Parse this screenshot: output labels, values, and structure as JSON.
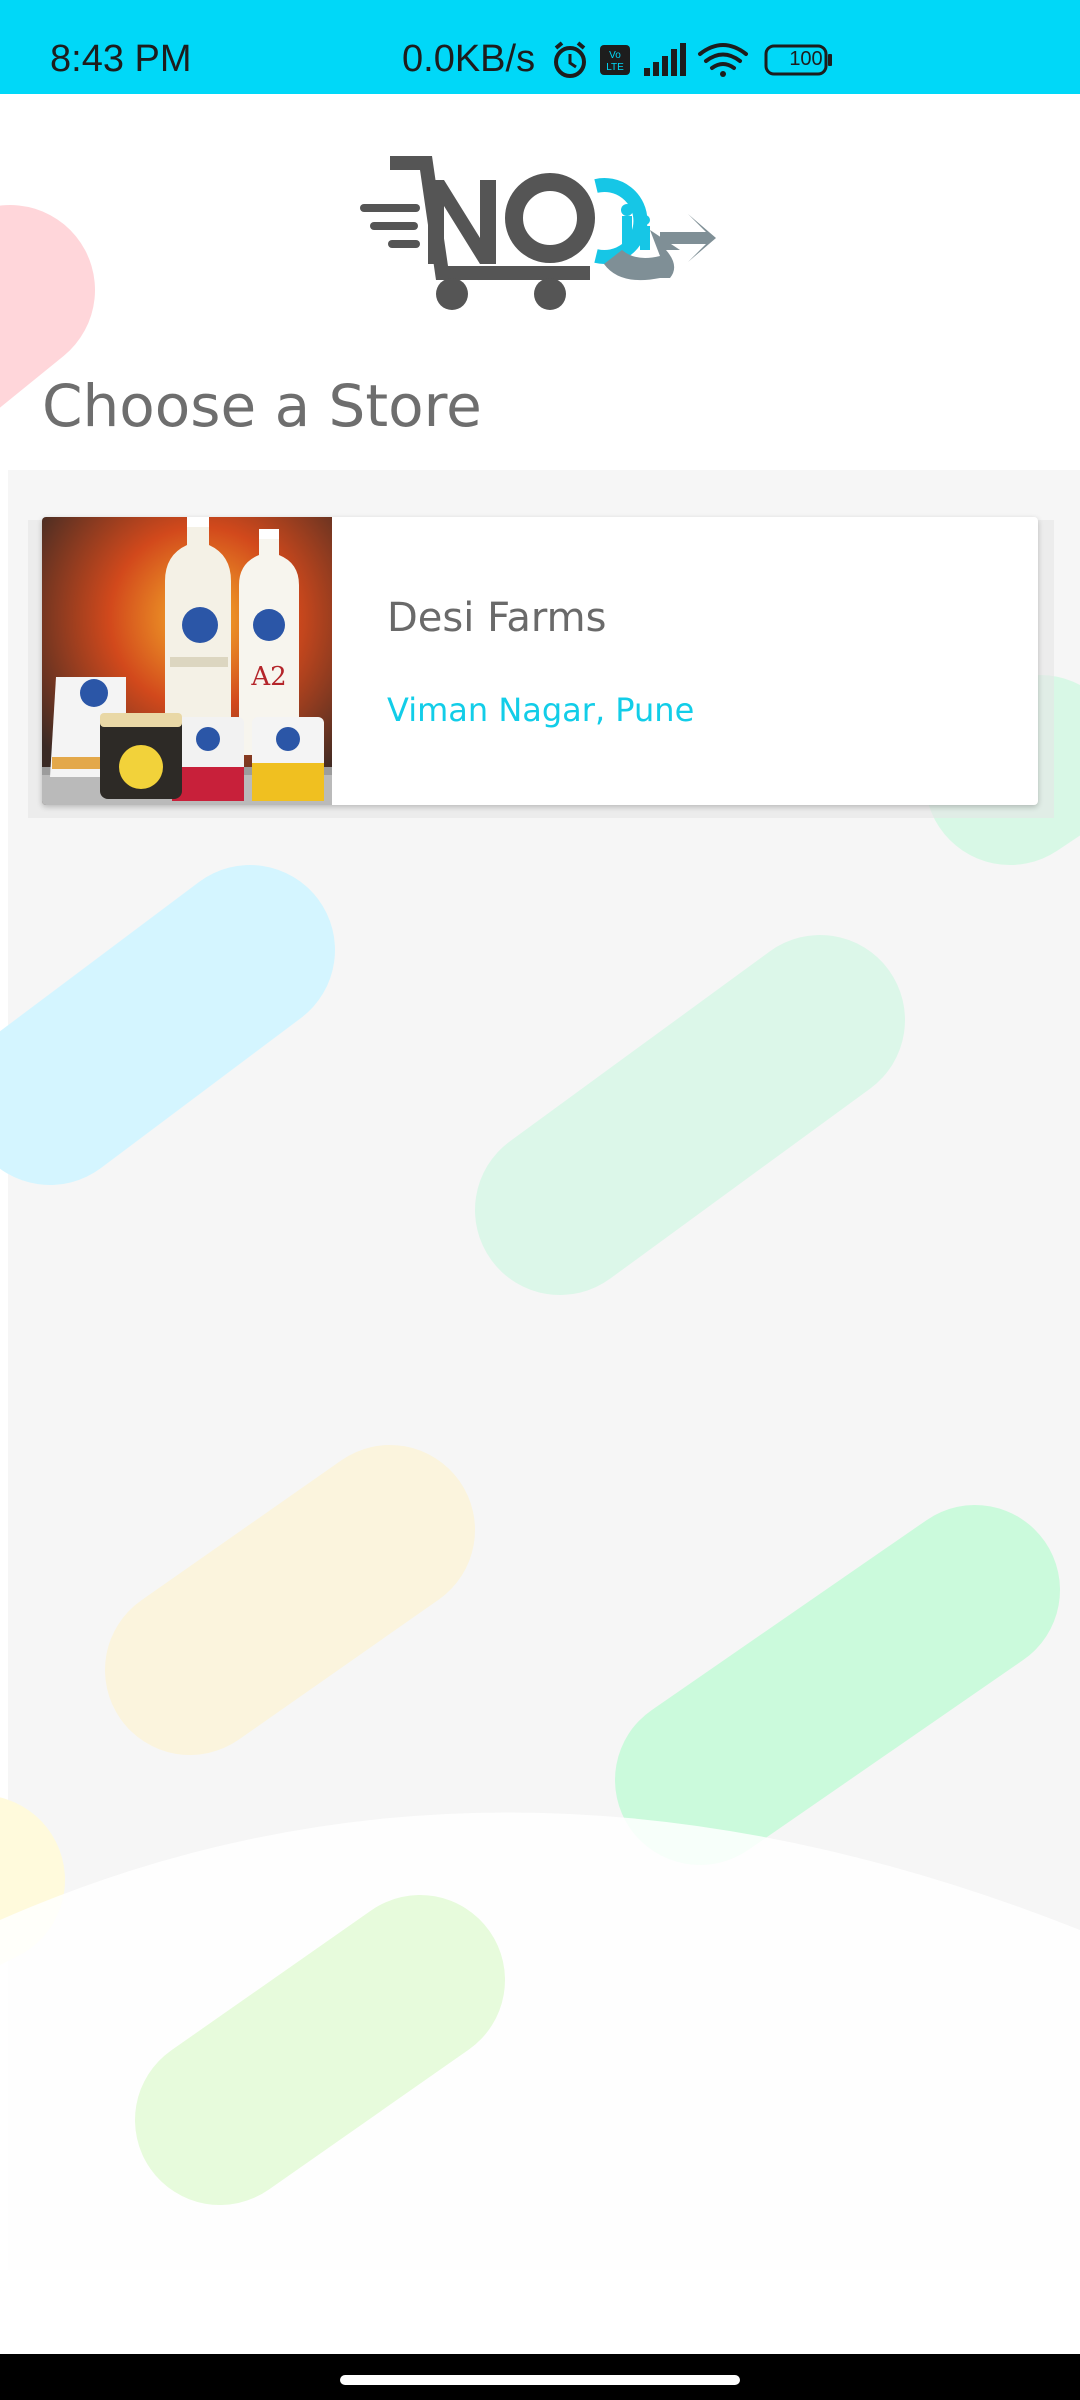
{
  "status_bar": {
    "time": "8:43 PM",
    "network_speed": "0.0KB/s",
    "battery": "100",
    "icons": [
      "alarm-icon",
      "volte-icon",
      "signal-icon",
      "wifi-icon",
      "battery-icon"
    ]
  },
  "header": {
    "logo_icon": "noq-cart-logo",
    "title": "Choose a Store"
  },
  "stores": [
    {
      "name": "Desi Farms",
      "location": "Viman Nagar, Pune"
    }
  ],
  "colors": {
    "status_bar": "#00d8f8",
    "accent": "#12cde8",
    "title_text": "#6e6e6e",
    "nav_bar": "#000000"
  }
}
